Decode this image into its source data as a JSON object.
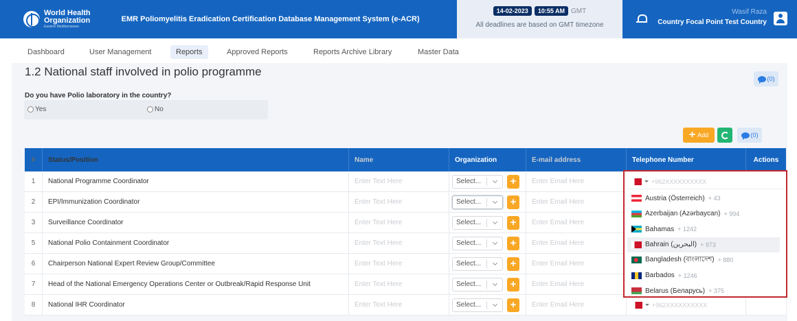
{
  "header": {
    "org_line1": "World Health",
    "org_line2": "Organization",
    "org_line3": "Eastern Mediterranean",
    "app_title": "EMR Poliomyelitis Eradication Certification Database Management System (e-ACR)",
    "date": "14-02-2023",
    "time": "10:55 AM",
    "timezone": "GMT",
    "deadline_note": "All deadlines are based on GMT timezone",
    "user_name": "Wasif Raza",
    "user_role": "Country Focal Point Test Country"
  },
  "nav": {
    "items": [
      "Dashboard",
      "User Management",
      "Reports",
      "Approved Reports",
      "Reports Archive Library",
      "Master Data"
    ],
    "active": "Reports"
  },
  "section": {
    "title": "1.2 National staff involved in polio programme",
    "comment_count": "(0)",
    "question": "Do you have Polio laboratory in the country?",
    "option_yes": "Yes",
    "option_no": "No",
    "add_label": "Add",
    "table_comment_count": "(0)"
  },
  "table": {
    "headers": [
      "#",
      "Status/Position",
      "Name",
      "Organization",
      "E-mail address",
      "Telephone Number",
      "Actions"
    ],
    "name_placeholder": "Enter Text Here",
    "org_placeholder": "Select...",
    "email_placeholder": "Enter Email Here",
    "phone_placeholder": "+962XXXXXXXXXX",
    "rows": [
      {
        "num": "1",
        "position": "National Programme Coordinator"
      },
      {
        "num": "2",
        "position": "EPI/Immunization Coordinator"
      },
      {
        "num": "3",
        "position": "Surveillance Coordinator"
      },
      {
        "num": "5",
        "position": "National Polio Containment Coordinator"
      },
      {
        "num": "6",
        "position": "Chairperson National Expert Review Group/Committee"
      },
      {
        "num": "7",
        "position": "Head of the National Emergency Operations Center or Outbreak/Rapid Response Unit"
      },
      {
        "num": "8",
        "position": "National IHR Coordinator"
      }
    ]
  },
  "country_dropdown": {
    "items": [
      {
        "name": "Austria (Österreich)",
        "code": "+ 43",
        "flag": "at"
      },
      {
        "name": "Azerbaijan (Azərbaycan)",
        "code": "+ 994",
        "flag": "az"
      },
      {
        "name": "Bahamas",
        "code": "+ 1242",
        "flag": "bs"
      },
      {
        "name": "Bahrain (‫البحرين‬‎)",
        "code": "+ 973",
        "flag": "bh"
      },
      {
        "name": "Bangladesh (বাংলাদেশ)",
        "code": "+ 880",
        "flag": "bd"
      },
      {
        "name": "Barbados",
        "code": "+ 1246",
        "flag": "bb"
      },
      {
        "name": "Belarus (Беларусь)",
        "code": "+ 375",
        "flag": "by"
      }
    ],
    "highlighted_index": 3
  },
  "colors": {
    "primary": "#1565c0",
    "accent_orange": "#f9a825",
    "accent_green": "#22b573",
    "dropdown_border": "#c0282d"
  }
}
